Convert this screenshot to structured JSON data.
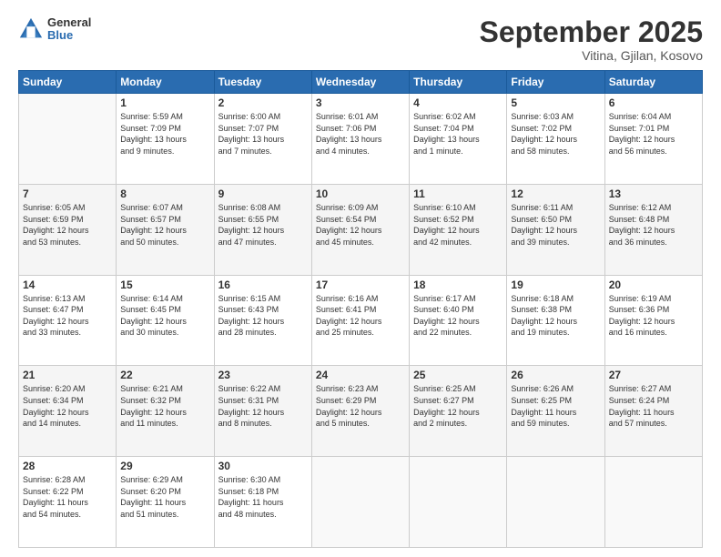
{
  "logo": {
    "line1": "General",
    "line2": "Blue"
  },
  "title": "September 2025",
  "location": "Vitina, Gjilan, Kosovo",
  "days_header": [
    "Sunday",
    "Monday",
    "Tuesday",
    "Wednesday",
    "Thursday",
    "Friday",
    "Saturday"
  ],
  "weeks": [
    [
      {
        "day": "",
        "info": ""
      },
      {
        "day": "1",
        "info": "Sunrise: 5:59 AM\nSunset: 7:09 PM\nDaylight: 13 hours\nand 9 minutes."
      },
      {
        "day": "2",
        "info": "Sunrise: 6:00 AM\nSunset: 7:07 PM\nDaylight: 13 hours\nand 7 minutes."
      },
      {
        "day": "3",
        "info": "Sunrise: 6:01 AM\nSunset: 7:06 PM\nDaylight: 13 hours\nand 4 minutes."
      },
      {
        "day": "4",
        "info": "Sunrise: 6:02 AM\nSunset: 7:04 PM\nDaylight: 13 hours\nand 1 minute."
      },
      {
        "day": "5",
        "info": "Sunrise: 6:03 AM\nSunset: 7:02 PM\nDaylight: 12 hours\nand 58 minutes."
      },
      {
        "day": "6",
        "info": "Sunrise: 6:04 AM\nSunset: 7:01 PM\nDaylight: 12 hours\nand 56 minutes."
      }
    ],
    [
      {
        "day": "7",
        "info": "Sunrise: 6:05 AM\nSunset: 6:59 PM\nDaylight: 12 hours\nand 53 minutes."
      },
      {
        "day": "8",
        "info": "Sunrise: 6:07 AM\nSunset: 6:57 PM\nDaylight: 12 hours\nand 50 minutes."
      },
      {
        "day": "9",
        "info": "Sunrise: 6:08 AM\nSunset: 6:55 PM\nDaylight: 12 hours\nand 47 minutes."
      },
      {
        "day": "10",
        "info": "Sunrise: 6:09 AM\nSunset: 6:54 PM\nDaylight: 12 hours\nand 45 minutes."
      },
      {
        "day": "11",
        "info": "Sunrise: 6:10 AM\nSunset: 6:52 PM\nDaylight: 12 hours\nand 42 minutes."
      },
      {
        "day": "12",
        "info": "Sunrise: 6:11 AM\nSunset: 6:50 PM\nDaylight: 12 hours\nand 39 minutes."
      },
      {
        "day": "13",
        "info": "Sunrise: 6:12 AM\nSunset: 6:48 PM\nDaylight: 12 hours\nand 36 minutes."
      }
    ],
    [
      {
        "day": "14",
        "info": "Sunrise: 6:13 AM\nSunset: 6:47 PM\nDaylight: 12 hours\nand 33 minutes."
      },
      {
        "day": "15",
        "info": "Sunrise: 6:14 AM\nSunset: 6:45 PM\nDaylight: 12 hours\nand 30 minutes."
      },
      {
        "day": "16",
        "info": "Sunrise: 6:15 AM\nSunset: 6:43 PM\nDaylight: 12 hours\nand 28 minutes."
      },
      {
        "day": "17",
        "info": "Sunrise: 6:16 AM\nSunset: 6:41 PM\nDaylight: 12 hours\nand 25 minutes."
      },
      {
        "day": "18",
        "info": "Sunrise: 6:17 AM\nSunset: 6:40 PM\nDaylight: 12 hours\nand 22 minutes."
      },
      {
        "day": "19",
        "info": "Sunrise: 6:18 AM\nSunset: 6:38 PM\nDaylight: 12 hours\nand 19 minutes."
      },
      {
        "day": "20",
        "info": "Sunrise: 6:19 AM\nSunset: 6:36 PM\nDaylight: 12 hours\nand 16 minutes."
      }
    ],
    [
      {
        "day": "21",
        "info": "Sunrise: 6:20 AM\nSunset: 6:34 PM\nDaylight: 12 hours\nand 14 minutes."
      },
      {
        "day": "22",
        "info": "Sunrise: 6:21 AM\nSunset: 6:32 PM\nDaylight: 12 hours\nand 11 minutes."
      },
      {
        "day": "23",
        "info": "Sunrise: 6:22 AM\nSunset: 6:31 PM\nDaylight: 12 hours\nand 8 minutes."
      },
      {
        "day": "24",
        "info": "Sunrise: 6:23 AM\nSunset: 6:29 PM\nDaylight: 12 hours\nand 5 minutes."
      },
      {
        "day": "25",
        "info": "Sunrise: 6:25 AM\nSunset: 6:27 PM\nDaylight: 12 hours\nand 2 minutes."
      },
      {
        "day": "26",
        "info": "Sunrise: 6:26 AM\nSunset: 6:25 PM\nDaylight: 11 hours\nand 59 minutes."
      },
      {
        "day": "27",
        "info": "Sunrise: 6:27 AM\nSunset: 6:24 PM\nDaylight: 11 hours\nand 57 minutes."
      }
    ],
    [
      {
        "day": "28",
        "info": "Sunrise: 6:28 AM\nSunset: 6:22 PM\nDaylight: 11 hours\nand 54 minutes."
      },
      {
        "day": "29",
        "info": "Sunrise: 6:29 AM\nSunset: 6:20 PM\nDaylight: 11 hours\nand 51 minutes."
      },
      {
        "day": "30",
        "info": "Sunrise: 6:30 AM\nSunset: 6:18 PM\nDaylight: 11 hours\nand 48 minutes."
      },
      {
        "day": "",
        "info": ""
      },
      {
        "day": "",
        "info": ""
      },
      {
        "day": "",
        "info": ""
      },
      {
        "day": "",
        "info": ""
      }
    ]
  ]
}
